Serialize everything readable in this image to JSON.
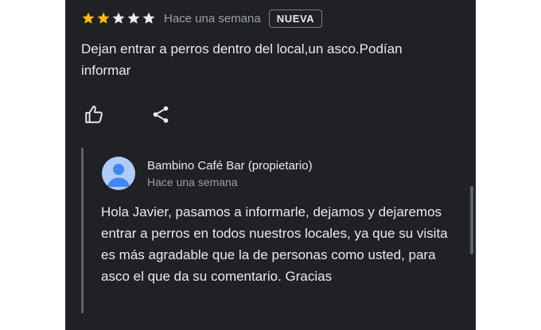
{
  "review": {
    "rating": 2,
    "rating_max": 5,
    "time": "Hace una semana",
    "badge": "NUEVA",
    "text": "Dejan entrar a perros dentro del local,un asco.Podían informar",
    "actions": {
      "like_icon": "thumb-up-icon",
      "share_icon": "share-icon"
    }
  },
  "owner_reply": {
    "name": "Bambino Café Bar (propietario)",
    "time": "Hace una semana",
    "avatar_icon": "person-avatar-icon",
    "text": "Hola Javier, pasamos a informarle, dejamos y dejaremos entrar a perros en todos nuestros locales, ya que su visita es más agradable que la de personas como usted, para asco el que da su comentario. Gracias"
  },
  "colors": {
    "background": "#202124",
    "star_filled": "#fbbc04",
    "star_empty": "#e8eaed",
    "text_primary": "#e8eaed",
    "text_secondary": "#9aa0a6",
    "avatar": "#aecbfa",
    "avatar_figure": "#4285f4"
  }
}
